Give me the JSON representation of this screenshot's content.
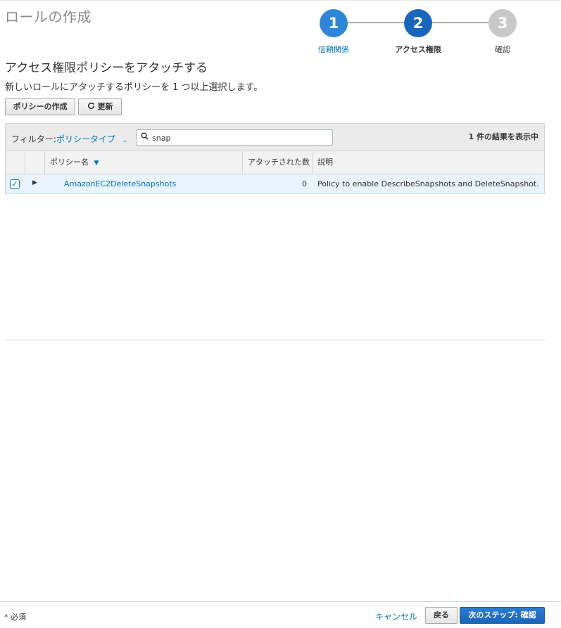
{
  "page": {
    "title": "ロールの作成"
  },
  "stepper": {
    "steps": [
      {
        "number": "1",
        "label": "信頼関係",
        "state": "completed",
        "color": "#2f86d6",
        "label_color": "#0073bb"
      },
      {
        "number": "2",
        "label": "アクセス権限",
        "state": "current",
        "color": "#1a66bc",
        "label_color": "#333333"
      },
      {
        "number": "3",
        "label": "確認",
        "state": "upcoming",
        "color": "#c8c8c8",
        "label_color": "#333333"
      }
    ]
  },
  "section": {
    "title": "アクセス権限ポリシーをアタッチする",
    "description": "新しいロールにアタッチするポリシーを 1 つ以上選択します。"
  },
  "toolbar": {
    "create_policy_label": "ポリシーの作成",
    "refresh_icon": "refresh-icon",
    "refresh_label": "更新"
  },
  "filter": {
    "label": "フィルター:",
    "type_label": "ポリシータイプ",
    "search_value": "snap",
    "result_text": "1 件の結果を表示中"
  },
  "table": {
    "columns": [
      "ポリシー名",
      "アタッチされた数",
      "説明"
    ],
    "rows": [
      {
        "checked": true,
        "name": "AmazonEC2DeleteSnapshots",
        "attached": "0",
        "description": "Policy to enable DescribeSnapshots and DeleteSnapshot."
      }
    ]
  },
  "footer": {
    "required_note": "* 必須",
    "cancel_label": "キャンセル",
    "back_label": "戻る",
    "next_label": "次のステップ: 確認"
  },
  "colors": {
    "accent": "#0073bb",
    "primary_button": "#1a66bc"
  }
}
